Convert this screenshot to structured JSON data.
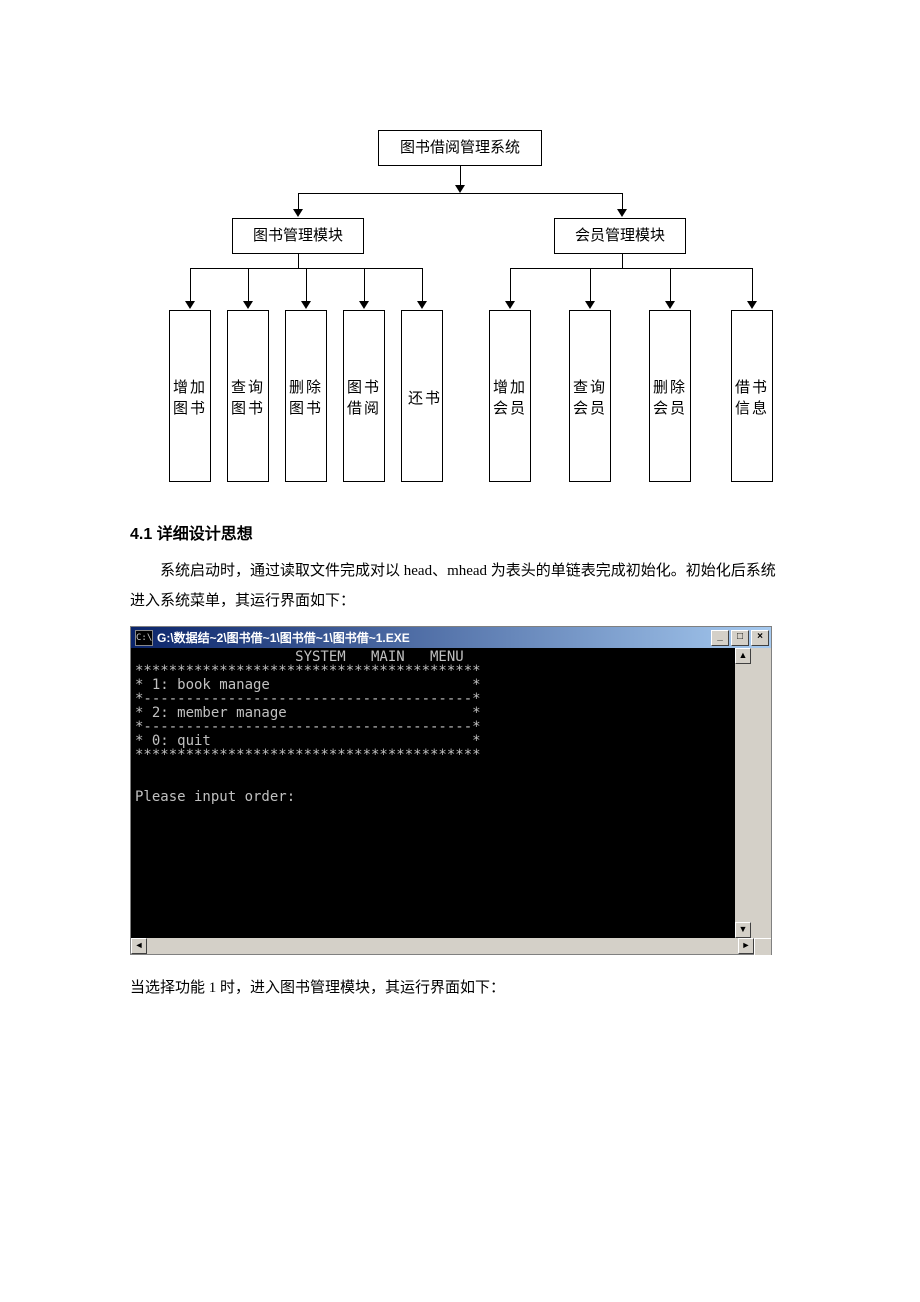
{
  "diagram": {
    "root": "图书借阅管理系统",
    "mod1": "图书管理模块",
    "mod2": "会员管理模块",
    "leaves": [
      "增加图书",
      "查询图书",
      "删除图书",
      "图书借阅",
      "还书",
      "增加会员",
      "查询会员",
      "删除会员",
      "借书信息"
    ]
  },
  "section_title": "4.1 详细设计思想",
  "para1": "系统启动时，通过读取文件完成对以 head、mhead 为表头的单链表完成初始化。初始化后系统进入系统菜单，其运行界面如下：",
  "para2": "当选择功能 1 时，进入图书管理模块，其运行界面如下：",
  "window": {
    "title": "G:\\数据结~2\\图书借~1\\图书借~1\\图书借~1.EXE",
    "console_lines": [
      "                   SYSTEM   MAIN   MENU",
      "*****************************************",
      "* 1: book manage                        *",
      "*---------------------------------------*",
      "* 2: member manage                      *",
      "*---------------------------------------*",
      "* 0: quit                               *",
      "*****************************************",
      "",
      "",
      "Please input order:"
    ]
  }
}
